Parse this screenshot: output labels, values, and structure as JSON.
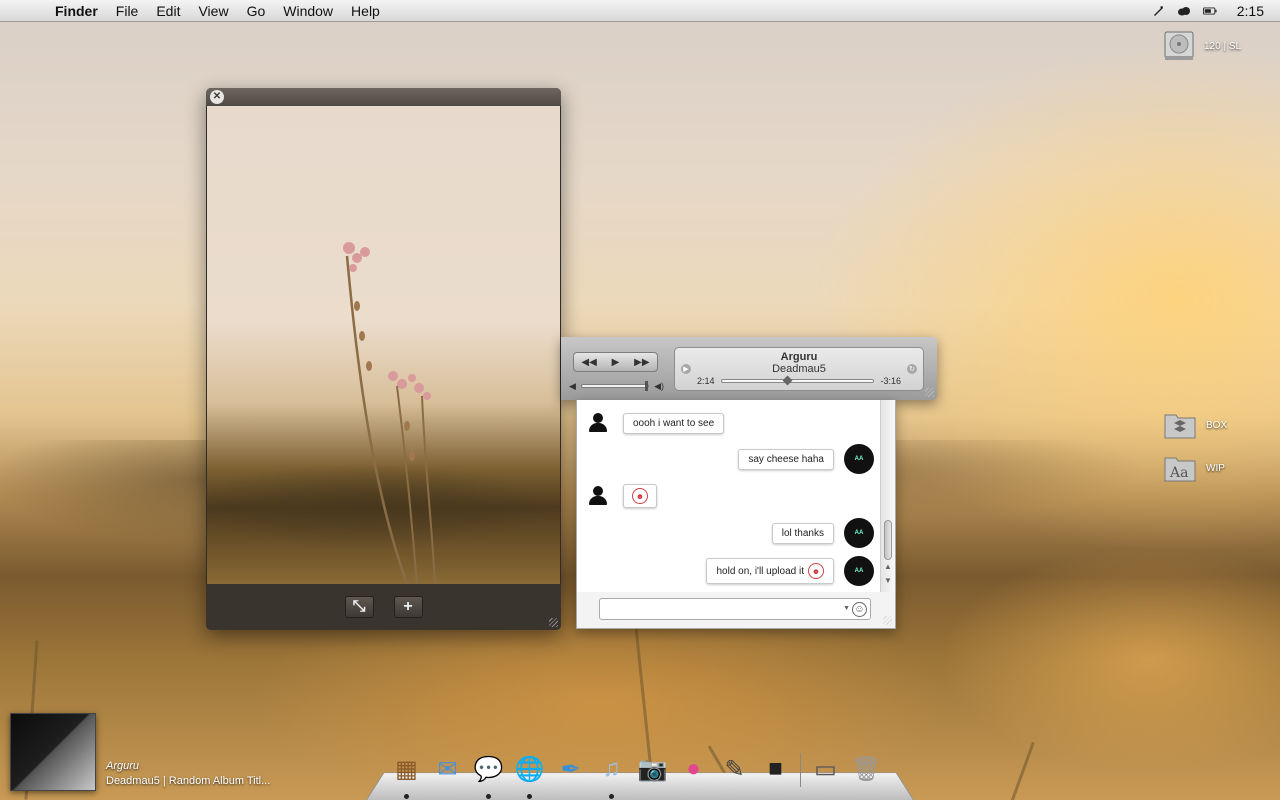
{
  "menubar": {
    "apple_glyph": "",
    "items": [
      "Finder",
      "File",
      "Edit",
      "View",
      "Go",
      "Window",
      "Help"
    ],
    "status_icons": [
      "script-icon",
      "cloud-icon",
      "battery-icon"
    ],
    "clock": "2:15"
  },
  "desktop_icons": [
    {
      "label": "120 | SL",
      "icon": "hard-drive-icon"
    },
    {
      "label": "BOX",
      "icon": "dropbox-folder-icon"
    },
    {
      "label": "WIP",
      "icon": "font-folder-icon"
    }
  ],
  "viewer": {
    "close_glyph": "✕",
    "fullscreen_glyph": "⤡",
    "add_glyph": "+"
  },
  "player": {
    "track": "Arguru",
    "artist": "Deadmau5",
    "elapsed": "2:14",
    "remaining": "-3:16",
    "progress": 0.41,
    "rewind_glyph": "◀◀",
    "play_glyph": "▶",
    "forward_glyph": "▶▶",
    "vol_low_glyph": "◀",
    "vol_high_glyph": "◀)"
  },
  "chat": {
    "messages": [
      {
        "from": "other",
        "text": "oooh i want to see"
      },
      {
        "from": "me",
        "text": "say cheese haha"
      },
      {
        "from": "other",
        "text": ""
      },
      {
        "from": "me",
        "text": "lol thanks"
      },
      {
        "from": "me",
        "text": "hold on, i'll upload it"
      }
    ],
    "buddy_avatar_text": "AA",
    "smiley_glyph": "☺"
  },
  "now_playing": {
    "title": "Arguru",
    "subtitle": "Deadmau5 | Random Album Titl..."
  },
  "dock": {
    "items": [
      {
        "name": "dock-item-appshelf",
        "glyph": "▦",
        "running": true
      },
      {
        "name": "dock-item-mail",
        "glyph": "✉",
        "running": false
      },
      {
        "name": "dock-item-ichat",
        "glyph": "💬",
        "running": true
      },
      {
        "name": "dock-item-safari",
        "glyph": "🌐",
        "running": true
      },
      {
        "name": "dock-item-quill",
        "glyph": "✒",
        "running": false
      },
      {
        "name": "dock-item-itunes",
        "glyph": "♫",
        "running": true
      },
      {
        "name": "dock-item-iphoto",
        "glyph": "📷",
        "running": false
      },
      {
        "name": "dock-item-drop",
        "glyph": "●",
        "running": false
      },
      {
        "name": "dock-item-pencil",
        "glyph": "✎",
        "running": false
      },
      {
        "name": "dock-item-camera",
        "glyph": "■",
        "running": false
      },
      {
        "name": "dock-item-documents",
        "glyph": "▭",
        "running": false
      },
      {
        "name": "dock-item-trash",
        "glyph": "🗑",
        "running": false
      }
    ]
  },
  "colors": {
    "accent": "#6d6760",
    "chat_bg": "#ffffff"
  }
}
